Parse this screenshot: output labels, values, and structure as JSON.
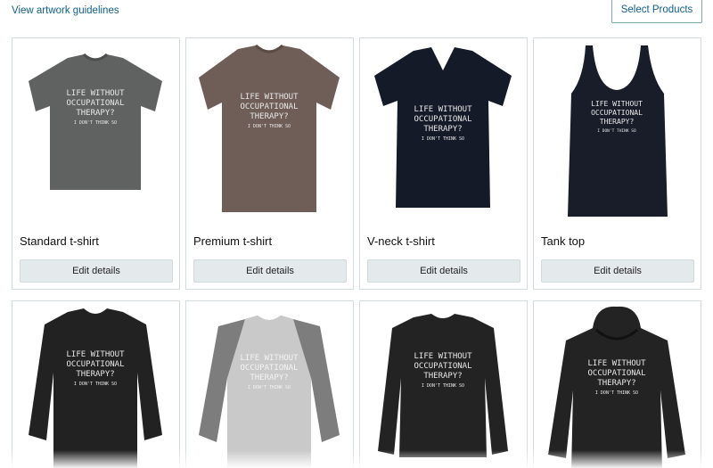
{
  "header": {
    "guidelines_link": "View artwork guidelines",
    "select_products": "Select Products"
  },
  "design_text": {
    "line1": "LIFE WITHOUT",
    "line2": "OCCUPATIONAL",
    "line3": "THERAPY?",
    "line4": "I DON'T THINK SO"
  },
  "products": [
    {
      "title": "Standard t-shirt",
      "button": "Edit details",
      "color": "#5f6260"
    },
    {
      "title": "Premium t-shirt",
      "button": "Edit details",
      "color": "#6f5e57"
    },
    {
      "title": "V-neck t-shirt",
      "button": "Edit details",
      "color": "#141a27"
    },
    {
      "title": "Tank top",
      "button": "Edit details",
      "color": "#181d29"
    },
    {
      "title": "",
      "button": "",
      "color": "#222222"
    },
    {
      "title": "",
      "button": "",
      "color": "#c9c9c9"
    },
    {
      "title": "",
      "button": "",
      "color": "#232323"
    },
    {
      "title": "",
      "button": "",
      "color": "#232323"
    }
  ]
}
